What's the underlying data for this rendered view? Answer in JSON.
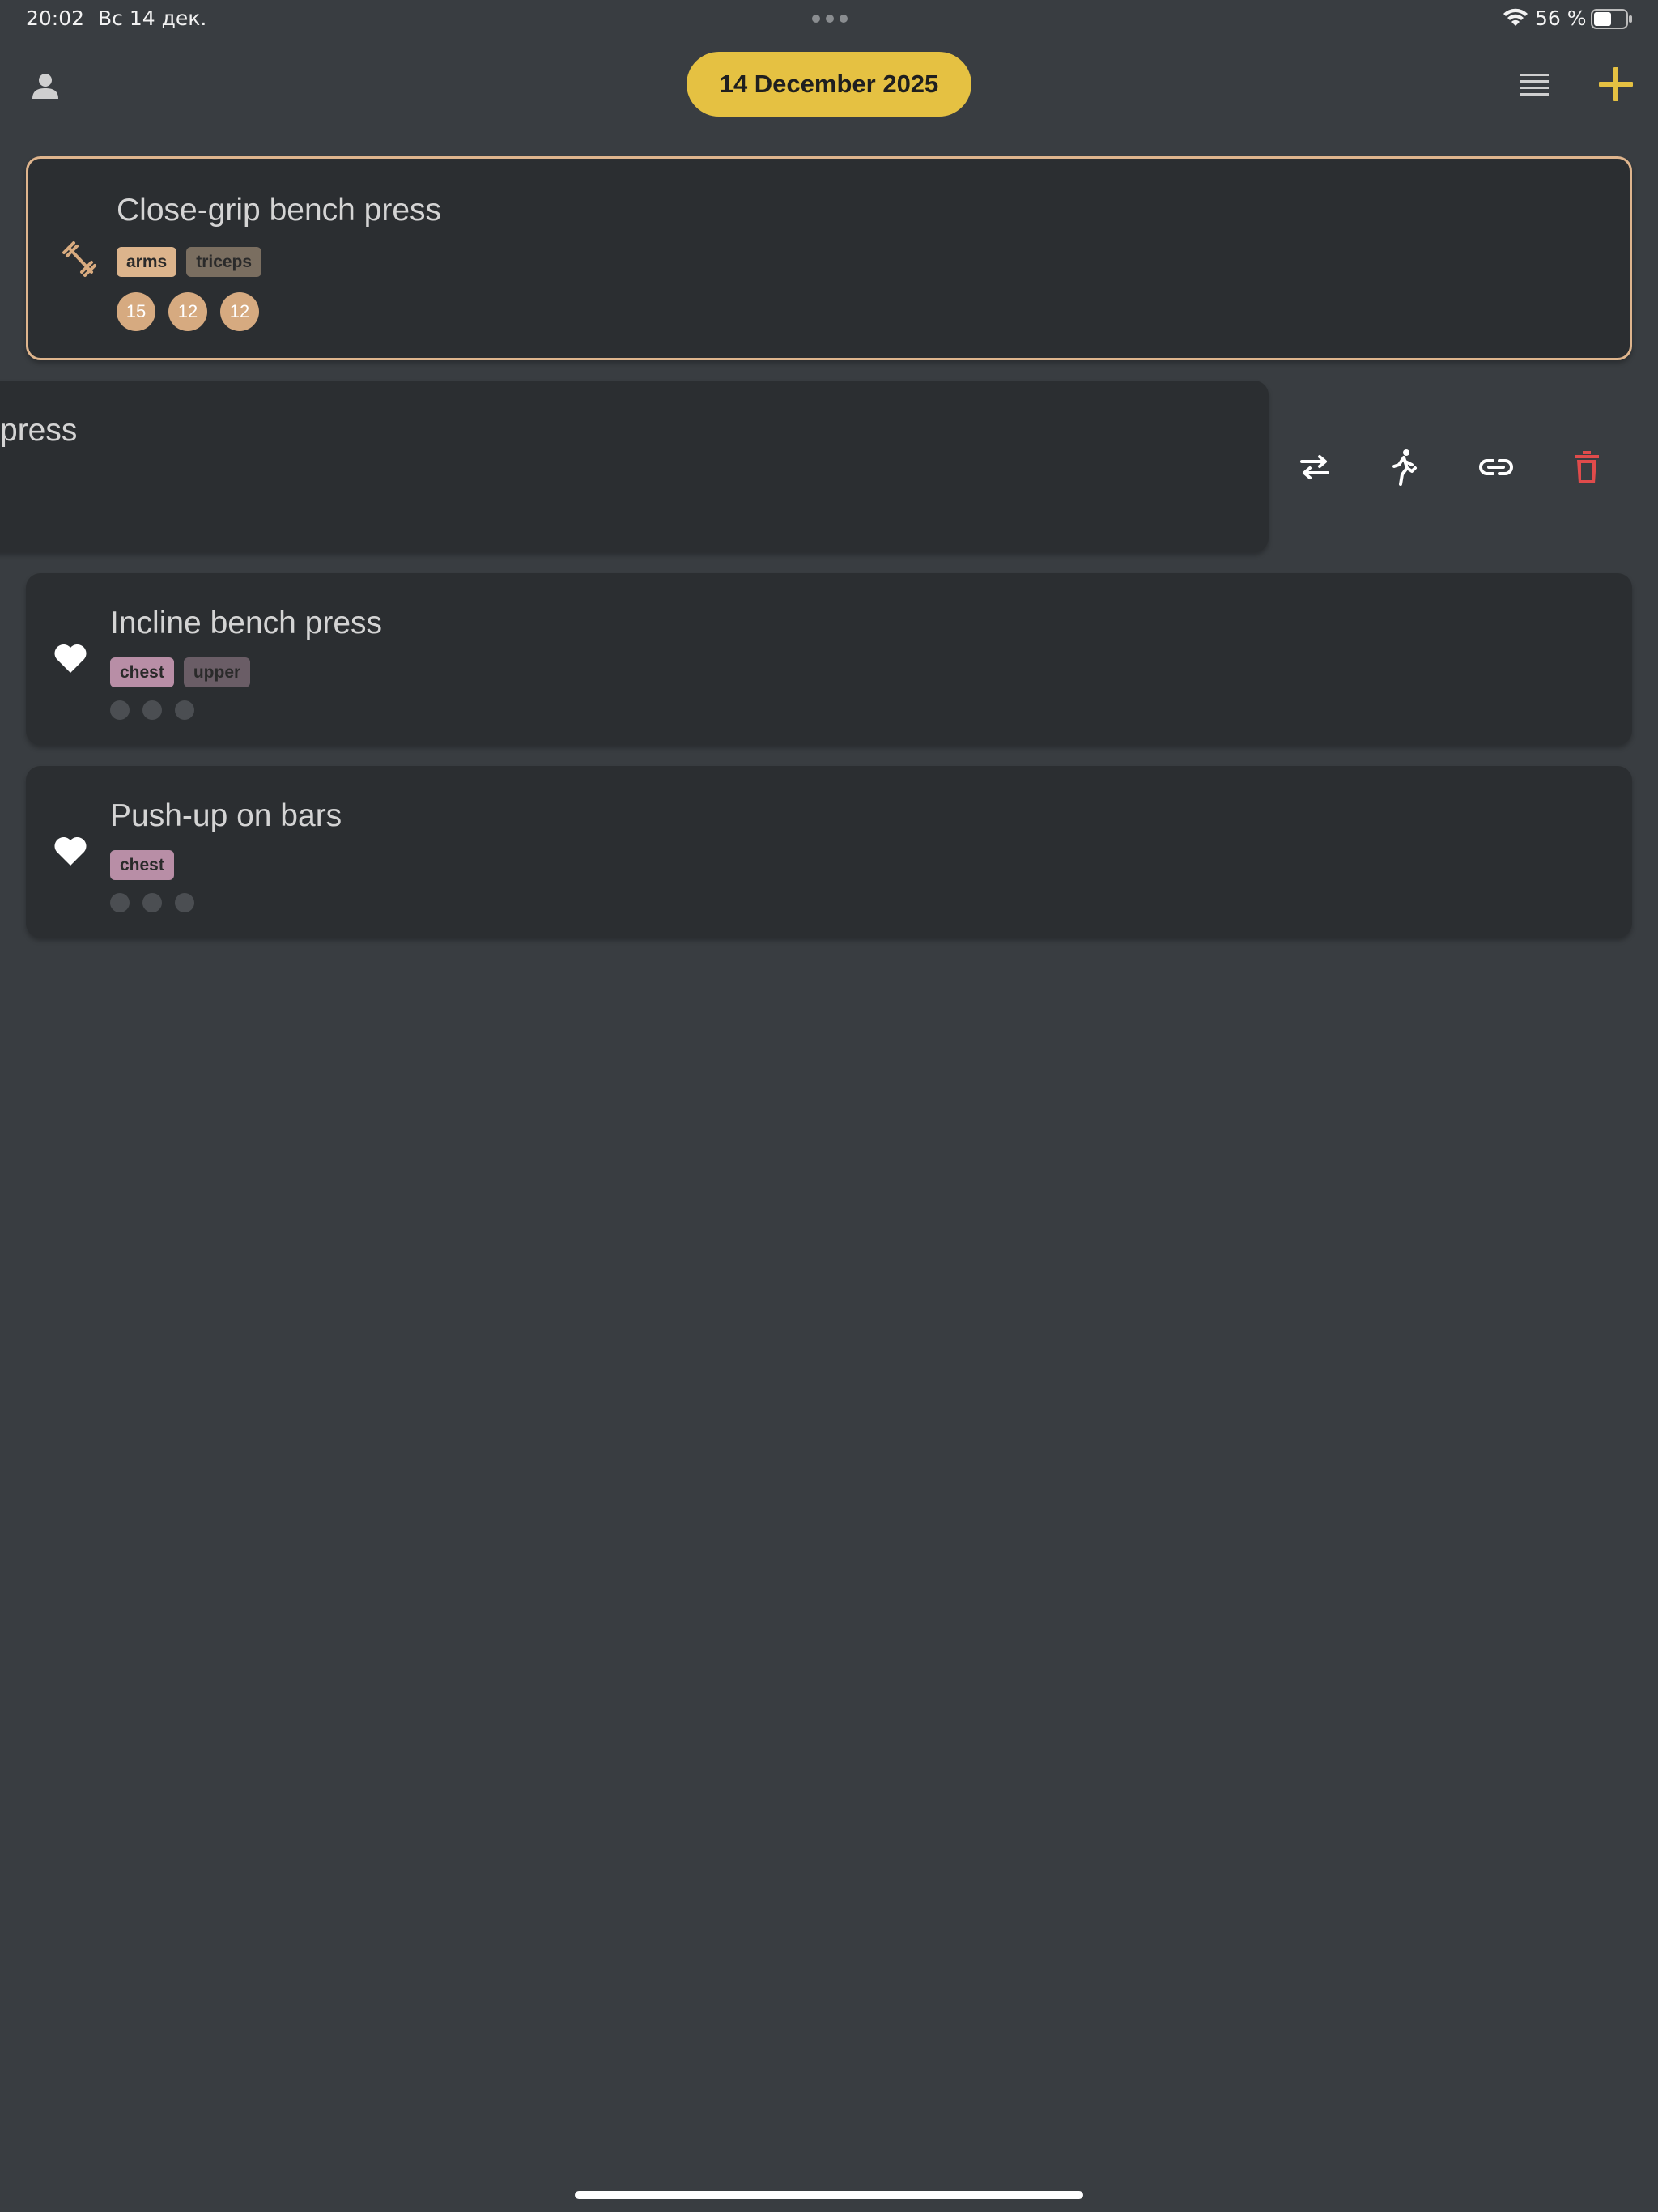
{
  "status_bar": {
    "time": "20:02",
    "date": "Вс 14 дек.",
    "battery_percent": "56 %",
    "battery_level": 0.56
  },
  "header": {
    "date_label": "14 December 2025",
    "accent_color": "#e5c142"
  },
  "exercises": [
    {
      "title": "Close-grip bench press",
      "icon": "barbell-icon",
      "selected": true,
      "tags": [
        {
          "label": "arms",
          "color": "#dcb48c"
        },
        {
          "label": "triceps",
          "color": "#7a6e60"
        }
      ],
      "sets": [
        "15",
        "12",
        "12"
      ]
    },
    {
      "title_fragment": "press",
      "swiped": true,
      "actions": [
        {
          "name": "swap-icon"
        },
        {
          "name": "run-icon"
        },
        {
          "name": "link-icon"
        },
        {
          "name": "trash-icon",
          "color": "#e04b4b"
        }
      ]
    },
    {
      "title": "Incline bench press",
      "icon": "heart-icon",
      "tags": [
        {
          "label": "chest",
          "color": "#b88ea6"
        },
        {
          "label": "upper",
          "color": "#6a5d66"
        }
      ],
      "empty_sets": 3
    },
    {
      "title": "Push-up on bars",
      "icon": "heart-icon",
      "tags": [
        {
          "label": "chest",
          "color": "#b88ea6"
        }
      ],
      "empty_sets": 3
    }
  ]
}
